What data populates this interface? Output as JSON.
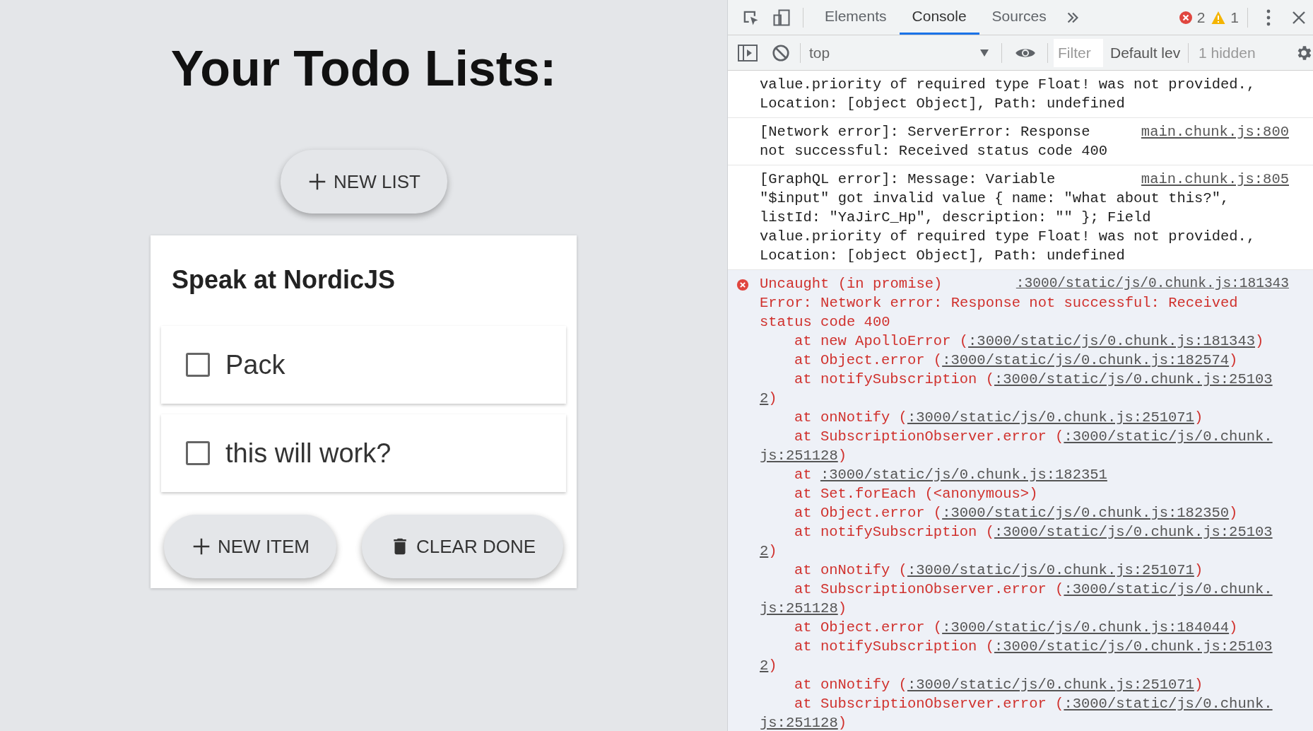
{
  "app": {
    "heading": "Your Todo Lists:",
    "new_list_button": {
      "label": "NEW LIST",
      "kind": "add"
    },
    "list": {
      "title": "Speak at NordicJS",
      "items": [
        {
          "label": "Pack",
          "checked": false
        },
        {
          "label": "this will work?",
          "checked": false
        }
      ],
      "buttons": [
        {
          "label": "NEW ITEM",
          "kind": "add"
        },
        {
          "label": "CLEAR DONE",
          "kind": "clear"
        }
      ]
    }
  },
  "devtools": {
    "tabs": [
      {
        "label": "Elements",
        "selected": false
      },
      {
        "label": "Console",
        "selected": true
      },
      {
        "label": "Sources",
        "selected": false
      }
    ],
    "error_count": "2",
    "warning_count": "1",
    "context": "top",
    "filter_placeholder": "Filter",
    "levels": "Default lev",
    "hidden": "1 hidden",
    "messages": [
      {
        "kind": "log",
        "lines": [
          "value.priority of required type Float! was not provided.,",
          "Location: [object Object], Path: undefined"
        ]
      },
      {
        "kind": "log",
        "source": "main.chunk.js:800",
        "lines": [
          "[Network error]: ServerError: Response",
          "not successful: Received status code 400"
        ]
      },
      {
        "kind": "log",
        "source": "main.chunk.js:805",
        "lines": [
          "[GraphQL error]: Message: Variable",
          "\"$input\" got invalid value { name: \"what about this?\",",
          "listId: \"YaJirC_Hp\", description: \"\" }; Field",
          "value.priority of required type Float! was not provided.,",
          "Location: [object Object], Path: undefined"
        ]
      },
      {
        "kind": "error",
        "source": ":3000/static/js/0.chunk.js:181343",
        "lines": [
          "Uncaught (in promise)",
          "Error: Network error: Response not successful: Received",
          "status code 400"
        ],
        "frames": [
          {
            "text": "at new ApolloError (",
            "link": ":3000/static/js/0.chunk.js:181343",
            "end": ")"
          },
          {
            "text": "at Object.error (",
            "link": ":3000/static/js/0.chunk.js:182574",
            "end": ")"
          },
          {
            "text": "at notifySubscription (",
            "link": ":3000/static/js/0.chunk.js:25103",
            "wrap": "2",
            "end": ")"
          },
          {
            "text": "at onNotify (",
            "link": ":3000/static/js/0.chunk.js:251071",
            "end": ")"
          },
          {
            "text": "at SubscriptionObserver.error (",
            "link": ":3000/static/js/0.chunk.",
            "wrap": "js:251128",
            "end": ")"
          },
          {
            "text": "at ",
            "link": ":3000/static/js/0.chunk.js:182351"
          },
          {
            "text": "at Set.forEach (<anonymous>)"
          },
          {
            "text": "at Object.error (",
            "link": ":3000/static/js/0.chunk.js:182350",
            "end": ")"
          },
          {
            "text": "at notifySubscription (",
            "link": ":3000/static/js/0.chunk.js:25103",
            "wrap": "2",
            "end": ")"
          },
          {
            "text": "at onNotify (",
            "link": ":3000/static/js/0.chunk.js:251071",
            "end": ")"
          },
          {
            "text": "at SubscriptionObserver.error (",
            "link": ":3000/static/js/0.chunk.",
            "wrap": "js:251128",
            "end": ")"
          },
          {
            "text": "at Object.error (",
            "link": ":3000/static/js/0.chunk.js:184044",
            "end": ")"
          },
          {
            "text": "at notifySubscription (",
            "link": ":3000/static/js/0.chunk.js:25103",
            "wrap": "2",
            "end": ")"
          },
          {
            "text": "at onNotify (",
            "link": ":3000/static/js/0.chunk.js:251071",
            "end": ")"
          },
          {
            "text": "at SubscriptionObserver.error (",
            "link": ":3000/static/js/0.chunk.",
            "wrap": "js:251128",
            "end": ")"
          }
        ]
      }
    ]
  }
}
